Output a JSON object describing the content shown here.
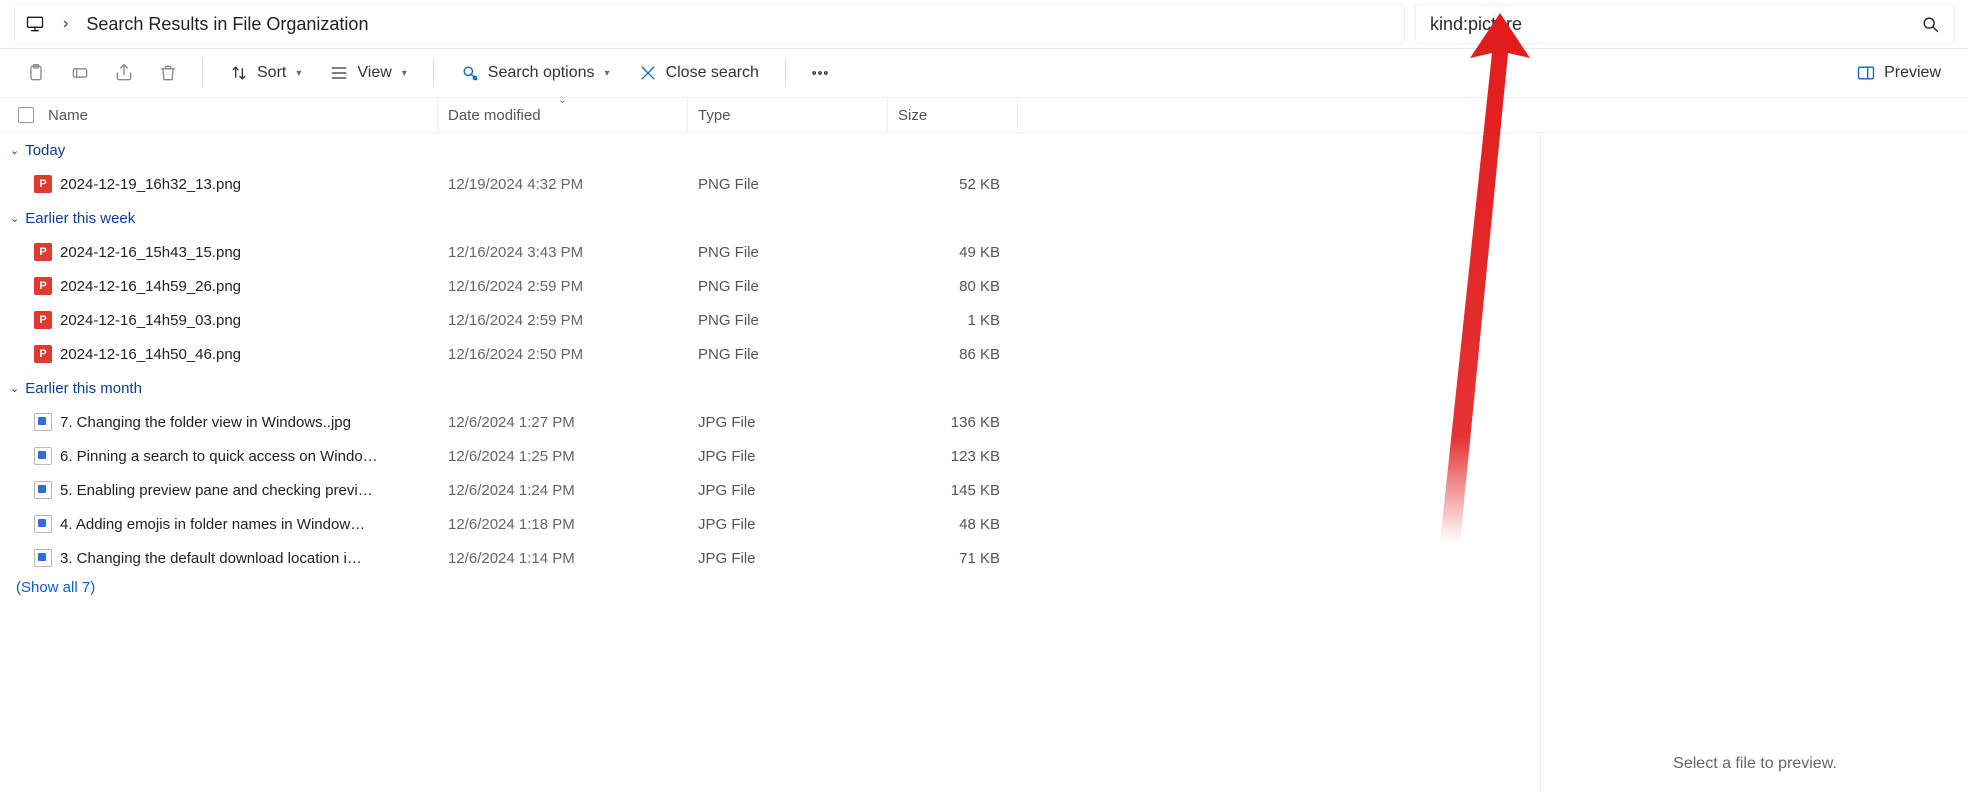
{
  "breadcrumb": {
    "title": "Search Results in File Organization"
  },
  "search": {
    "value": "kind:picture"
  },
  "toolbar": {
    "sort": "Sort",
    "view": "View",
    "search_options": "Search options",
    "close_search": "Close search",
    "preview": "Preview"
  },
  "columns": {
    "name": "Name",
    "date": "Date modified",
    "type": "Type",
    "size": "Size"
  },
  "groups": [
    {
      "label": "Today",
      "rows": [
        {
          "icon": "png",
          "name": "2024-12-19_16h32_13.png",
          "date": "12/19/2024 4:32 PM",
          "type": "PNG File",
          "size": "52 KB"
        }
      ]
    },
    {
      "label": "Earlier this week",
      "rows": [
        {
          "icon": "png",
          "name": "2024-12-16_15h43_15.png",
          "date": "12/16/2024 3:43 PM",
          "type": "PNG File",
          "size": "49 KB"
        },
        {
          "icon": "png",
          "name": "2024-12-16_14h59_26.png",
          "date": "12/16/2024 2:59 PM",
          "type": "PNG File",
          "size": "80 KB"
        },
        {
          "icon": "png",
          "name": "2024-12-16_14h59_03.png",
          "date": "12/16/2024 2:59 PM",
          "type": "PNG File",
          "size": "1 KB"
        },
        {
          "icon": "png",
          "name": "2024-12-16_14h50_46.png",
          "date": "12/16/2024 2:50 PM",
          "type": "PNG File",
          "size": "86 KB"
        }
      ]
    },
    {
      "label": "Earlier this month",
      "rows": [
        {
          "icon": "jpg",
          "name": "7. Changing the folder view in Windows..jpg",
          "date": "12/6/2024 1:27 PM",
          "type": "JPG File",
          "size": "136 KB"
        },
        {
          "icon": "jpg",
          "name": "6. Pinning a search to quick access on Windo…",
          "date": "12/6/2024 1:25 PM",
          "type": "JPG File",
          "size": "123 KB"
        },
        {
          "icon": "jpg",
          "name": "5. Enabling preview pane and checking previ…",
          "date": "12/6/2024 1:24 PM",
          "type": "JPG File",
          "size": "145 KB"
        },
        {
          "icon": "jpg",
          "name": "4. Adding emojis in folder names in Window…",
          "date": "12/6/2024 1:18 PM",
          "type": "JPG File",
          "size": "48 KB"
        },
        {
          "icon": "jpg",
          "name": "3. Changing the default download location i…",
          "date": "12/6/2024 1:14 PM",
          "type": "JPG File",
          "size": "71 KB"
        }
      ],
      "show_all": "(Show all 7)"
    }
  ],
  "preview_empty": "Select a file to preview."
}
